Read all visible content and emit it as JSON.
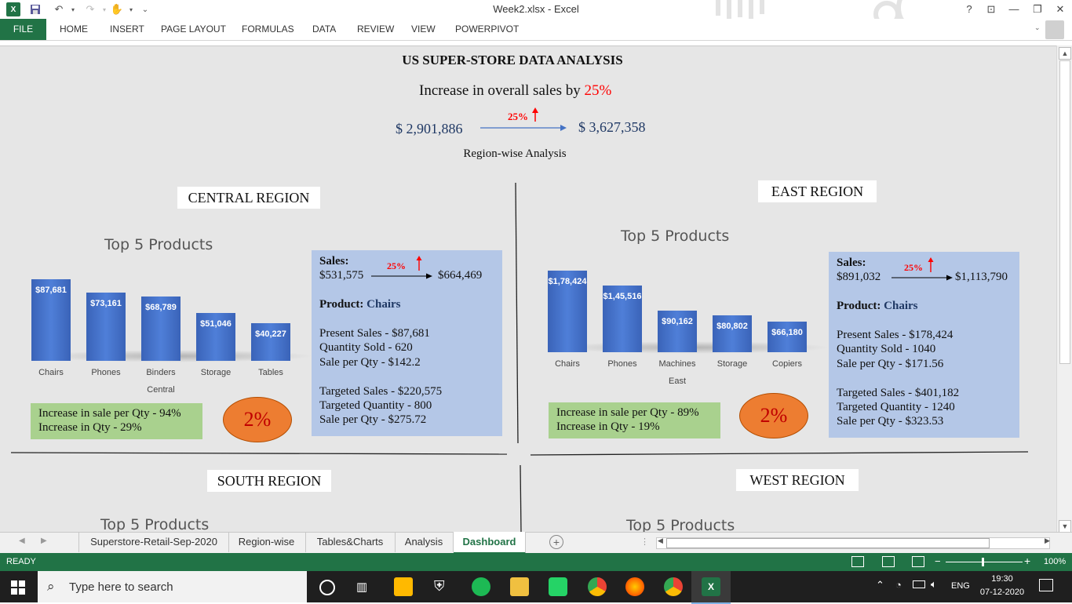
{
  "window": {
    "title": "Week2.xlsx - Excel",
    "help": "?",
    "controls": [
      "⊡",
      "—",
      "❐",
      "✕"
    ]
  },
  "ribbon": {
    "file": "FILE",
    "tabs": [
      "HOME",
      "INSERT",
      "PAGE LAYOUT",
      "FORMULAS",
      "DATA",
      "REVIEW",
      "VIEW",
      "POWERPIVOT"
    ]
  },
  "dashboard": {
    "title": "US SUPER-STORE DATA ANALYSIS",
    "increase_text": "Increase in overall sales by",
    "increase_pct": "25%",
    "arrow_pct": "25%",
    "from_value": "$ 2,901,886",
    "to_value": "$ 3,627,358",
    "subtitle": "Region-wise Analysis"
  },
  "central": {
    "region": "CENTRAL REGION",
    "top5": "Top 5 Products",
    "chart_data": {
      "type": "bar",
      "categories": [
        "Chairs",
        "Phones",
        "Binders",
        "Storage",
        "Tables"
      ],
      "values": [
        87681,
        73161,
        68789,
        51046,
        40227
      ],
      "data_labels": [
        "$87,681",
        "$73,161",
        "$68,789",
        "$51,046",
        "$40,227"
      ],
      "xlabel": "Central"
    },
    "sales_label": "Sales:",
    "sales_pct": "25%",
    "sales_from": "$531,575",
    "sales_to": "$664,469",
    "product_label": "Product:",
    "product_name": "Chairs",
    "present_sales": "Present Sales - $87,681",
    "quantity_sold": "Quantity Sold - 620",
    "sale_per_qty": "Sale per Qty - $142.2",
    "targeted_sales": "Targeted Sales - $220,575",
    "targeted_qty": "Targeted Quantity - 800",
    "target_sale_per_qty": "Sale per Qty - $275.72",
    "inc_sale_per_qty": "Increase in sale per Qty - 94%",
    "inc_qty": "Increase in Qty - 29%",
    "circle_pct": "2%"
  },
  "east": {
    "region": "EAST REGION",
    "top5": "Top 5 Products",
    "chart_data": {
      "type": "bar",
      "categories": [
        "Chairs",
        "Phones",
        "Machines",
        "Storage",
        "Copiers"
      ],
      "values": [
        178424,
        145516,
        90162,
        80802,
        66180
      ],
      "data_labels": [
        "$1,78,424",
        "$1,45,516",
        "$90,162",
        "$80,802",
        "$66,180"
      ],
      "xlabel": "East"
    },
    "sales_label": "Sales:",
    "sales_pct": "25%",
    "sales_from": "$891,032",
    "sales_to": "$1,113,790",
    "product_label": "Product:",
    "product_name": "Chairs",
    "present_sales": "Present Sales - $178,424",
    "quantity_sold": "Quantity Sold - 1040",
    "sale_per_qty": "Sale per Qty - $171.56",
    "targeted_sales": "Targeted Sales - $401,182",
    "targeted_qty": "Targeted Quantity - 1240",
    "target_sale_per_qty": "Sale per Qty - $323.53",
    "inc_sale_per_qty": "Increase in sale per Qty - 89%",
    "inc_qty": "Increase in Qty - 19%",
    "circle_pct": "2%"
  },
  "south": {
    "region": "SOUTH REGION",
    "top5": "Top 5 Products"
  },
  "west": {
    "region": "WEST REGION",
    "top5": "Top 5 Products"
  },
  "sheet_tabs": [
    "Superstore-Retail-Sep-2020",
    "Region-wise",
    "Tables&Charts",
    "Analysis",
    "Dashboard"
  ],
  "active_tab": "Dashboard",
  "status": {
    "ready": "READY",
    "zoom": "100%"
  },
  "taskbar": {
    "search_placeholder": "Type here to search",
    "lang": "ENG",
    "time": "19:30",
    "date": "07-12-2020"
  },
  "colors": {
    "excel_green": "#217346",
    "bar_blue": "#4472c4",
    "info_blue": "#b4c7e7",
    "green_box": "#a9d18e",
    "orange": "#ed7d31",
    "red": "#ff0000",
    "navy": "#1f3864"
  }
}
